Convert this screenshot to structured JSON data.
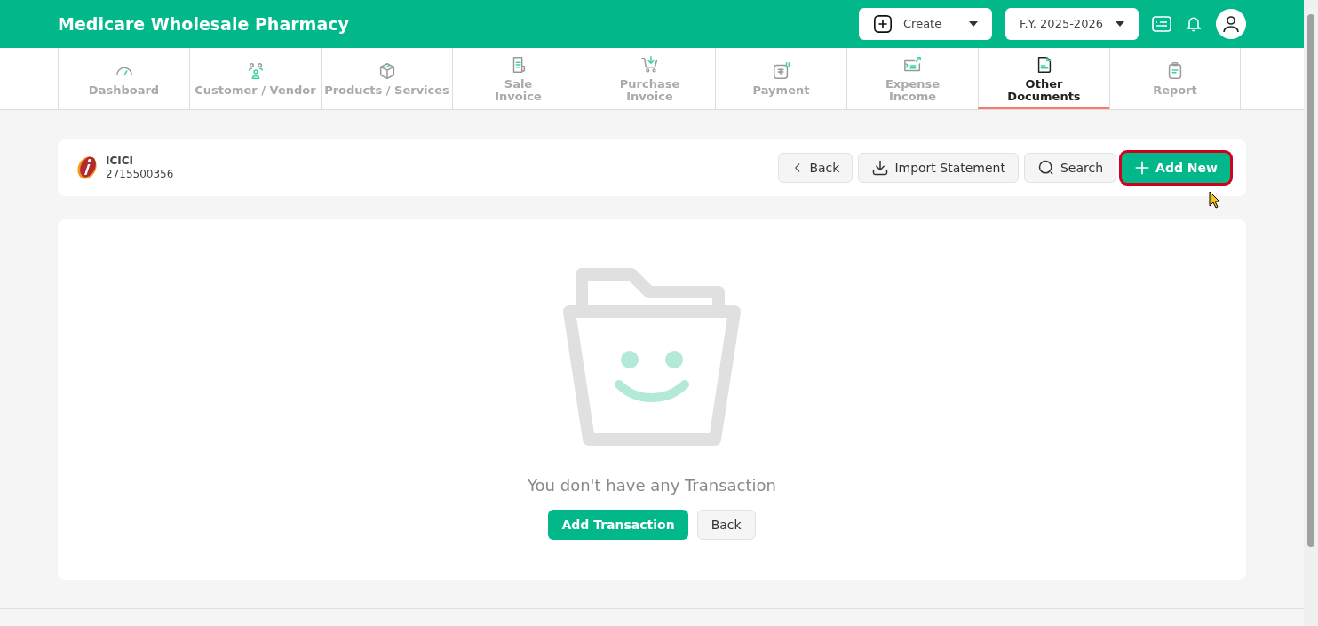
{
  "header": {
    "title": "Medicare Wholesale Pharmacy",
    "create_button": "Create",
    "fiscal_year": "F.Y. 2025-2026"
  },
  "nav_tabs": [
    {
      "kind": "gauge",
      "lines": [
        "Dashboard"
      ],
      "selected": false
    },
    {
      "kind": "people",
      "lines": [
        "Customer / Vendor"
      ],
      "selected": false
    },
    {
      "kind": "box",
      "lines": [
        "Products / Services"
      ],
      "selected": false
    },
    {
      "kind": "receipt",
      "lines": [
        "Sale",
        "Invoice"
      ],
      "selected": false
    },
    {
      "kind": "cart",
      "lines": [
        "Purchase",
        "Invoice"
      ],
      "selected": false
    },
    {
      "kind": "rupee",
      "lines": [
        "Payment"
      ],
      "selected": false
    },
    {
      "kind": "money",
      "lines": [
        "Expense",
        "Income"
      ],
      "selected": false
    },
    {
      "kind": "document",
      "lines": [
        "Other",
        "Documents"
      ],
      "selected": true
    },
    {
      "kind": "clipboard",
      "lines": [
        "Report"
      ],
      "selected": false
    }
  ],
  "account": {
    "bank": "ICICI",
    "number": "2715500356"
  },
  "actions": [
    {
      "kind": "back",
      "label": "Back",
      "primary": false,
      "highlighted": false
    },
    {
      "kind": "import",
      "label": "Import Statement",
      "primary": false,
      "highlighted": false
    },
    {
      "kind": "search",
      "label": "Search",
      "primary": false,
      "highlighted": false
    },
    {
      "kind": "add",
      "label": "Add New",
      "primary": true,
      "highlighted": true
    }
  ],
  "empty_state": {
    "message": "You don't have any Transaction",
    "buttons": [
      {
        "label": "Add Transaction",
        "primary": true
      },
      {
        "label": "Back",
        "primary": false
      }
    ]
  }
}
